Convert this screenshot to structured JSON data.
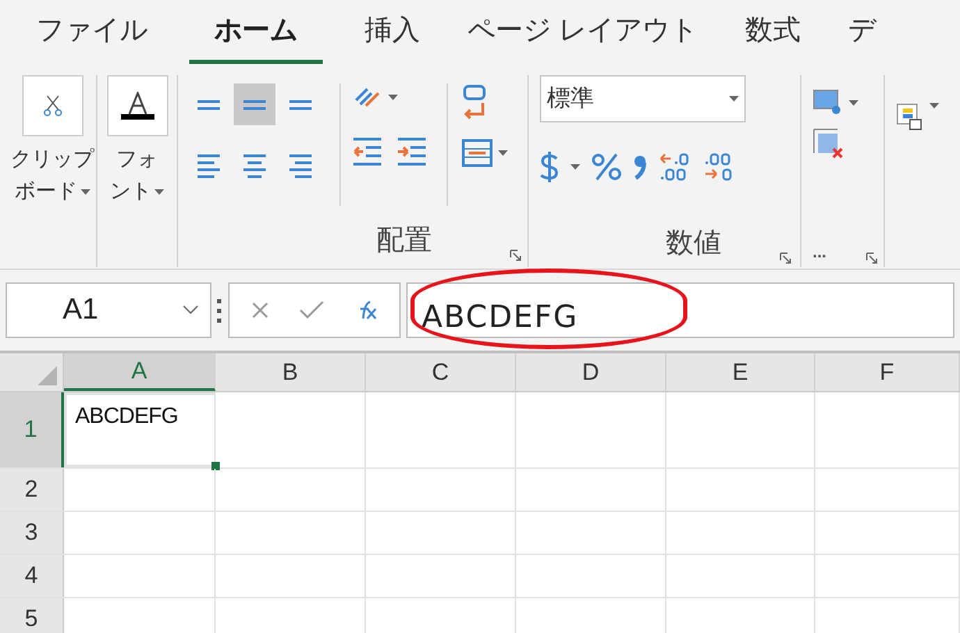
{
  "tabs": [
    {
      "label": "ファイル",
      "selected": false
    },
    {
      "label": "ホーム",
      "selected": true
    },
    {
      "label": "挿入",
      "selected": false
    },
    {
      "label": "ページ レイアウト",
      "selected": false
    },
    {
      "label": "数式",
      "selected": false
    },
    {
      "label": "デ",
      "selected": false
    }
  ],
  "ribbon": {
    "clipboard": {
      "line1": "クリップ",
      "line2": "ボード"
    },
    "font": {
      "line1": "フォ",
      "line2": "ント"
    },
    "alignment": {
      "label": "配置",
      "vertical": [
        {
          "selected": false
        },
        {
          "selected": true
        },
        {
          "selected": false
        }
      ]
    },
    "number": {
      "label": "数値",
      "format": "標準"
    },
    "styles": {
      "more": "..."
    }
  },
  "formula_bar": {
    "name_box": "A1",
    "formula": "ABCDEFG"
  },
  "highlight": {
    "on": true
  },
  "grid": {
    "columns": [
      {
        "label": "A",
        "selected": true
      },
      {
        "label": "B",
        "selected": false
      },
      {
        "label": "C",
        "selected": false
      },
      {
        "label": "D",
        "selected": false
      },
      {
        "label": "E",
        "selected": false
      },
      {
        "label": "F",
        "selected": false
      }
    ],
    "rows": [
      {
        "label": "1",
        "selected": true,
        "cells": [
          "ABCDEFG"
        ]
      },
      {
        "label": "2",
        "selected": false,
        "cells": []
      },
      {
        "label": "3",
        "selected": false,
        "cells": []
      },
      {
        "label": "4",
        "selected": false,
        "cells": []
      },
      {
        "label": "5",
        "selected": false,
        "cells": []
      }
    ]
  }
}
